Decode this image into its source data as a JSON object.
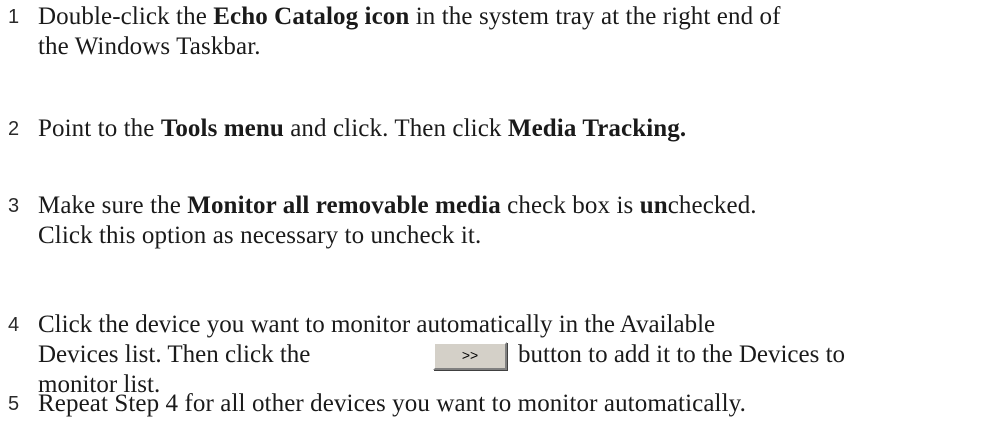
{
  "steps": [
    {
      "number": "1",
      "lines": [
        {
          "t1": "Double-click the ",
          "b1": "Echo Catalog icon",
          "t2": " in the system tray at the right end of"
        },
        {
          "t1": "the Windows Taskbar."
        }
      ]
    },
    {
      "number": "2",
      "t1": "Point to the ",
      "b1": "Tools menu",
      "t2": " and click. Then click ",
      "b2": "Media Tracking."
    },
    {
      "number": "3",
      "line1": {
        "t1": "Make sure the ",
        "b1": "Monitor all removable media",
        "t2": " check box is ",
        "b2": "un",
        "t3": "checked."
      },
      "line2": "Click this option as necessary to uncheck it."
    },
    {
      "number": "4",
      "line1": "Click the device you want to monitor automatically in the Available",
      "line2a": "Devices list. Then click the",
      "button_label": ">>",
      "line2b": "button to add it to the Devices to",
      "line3": "monitor list."
    },
    {
      "number": "5",
      "text": "Repeat Step 4 for all other devices you want to monitor automatically."
    }
  ]
}
